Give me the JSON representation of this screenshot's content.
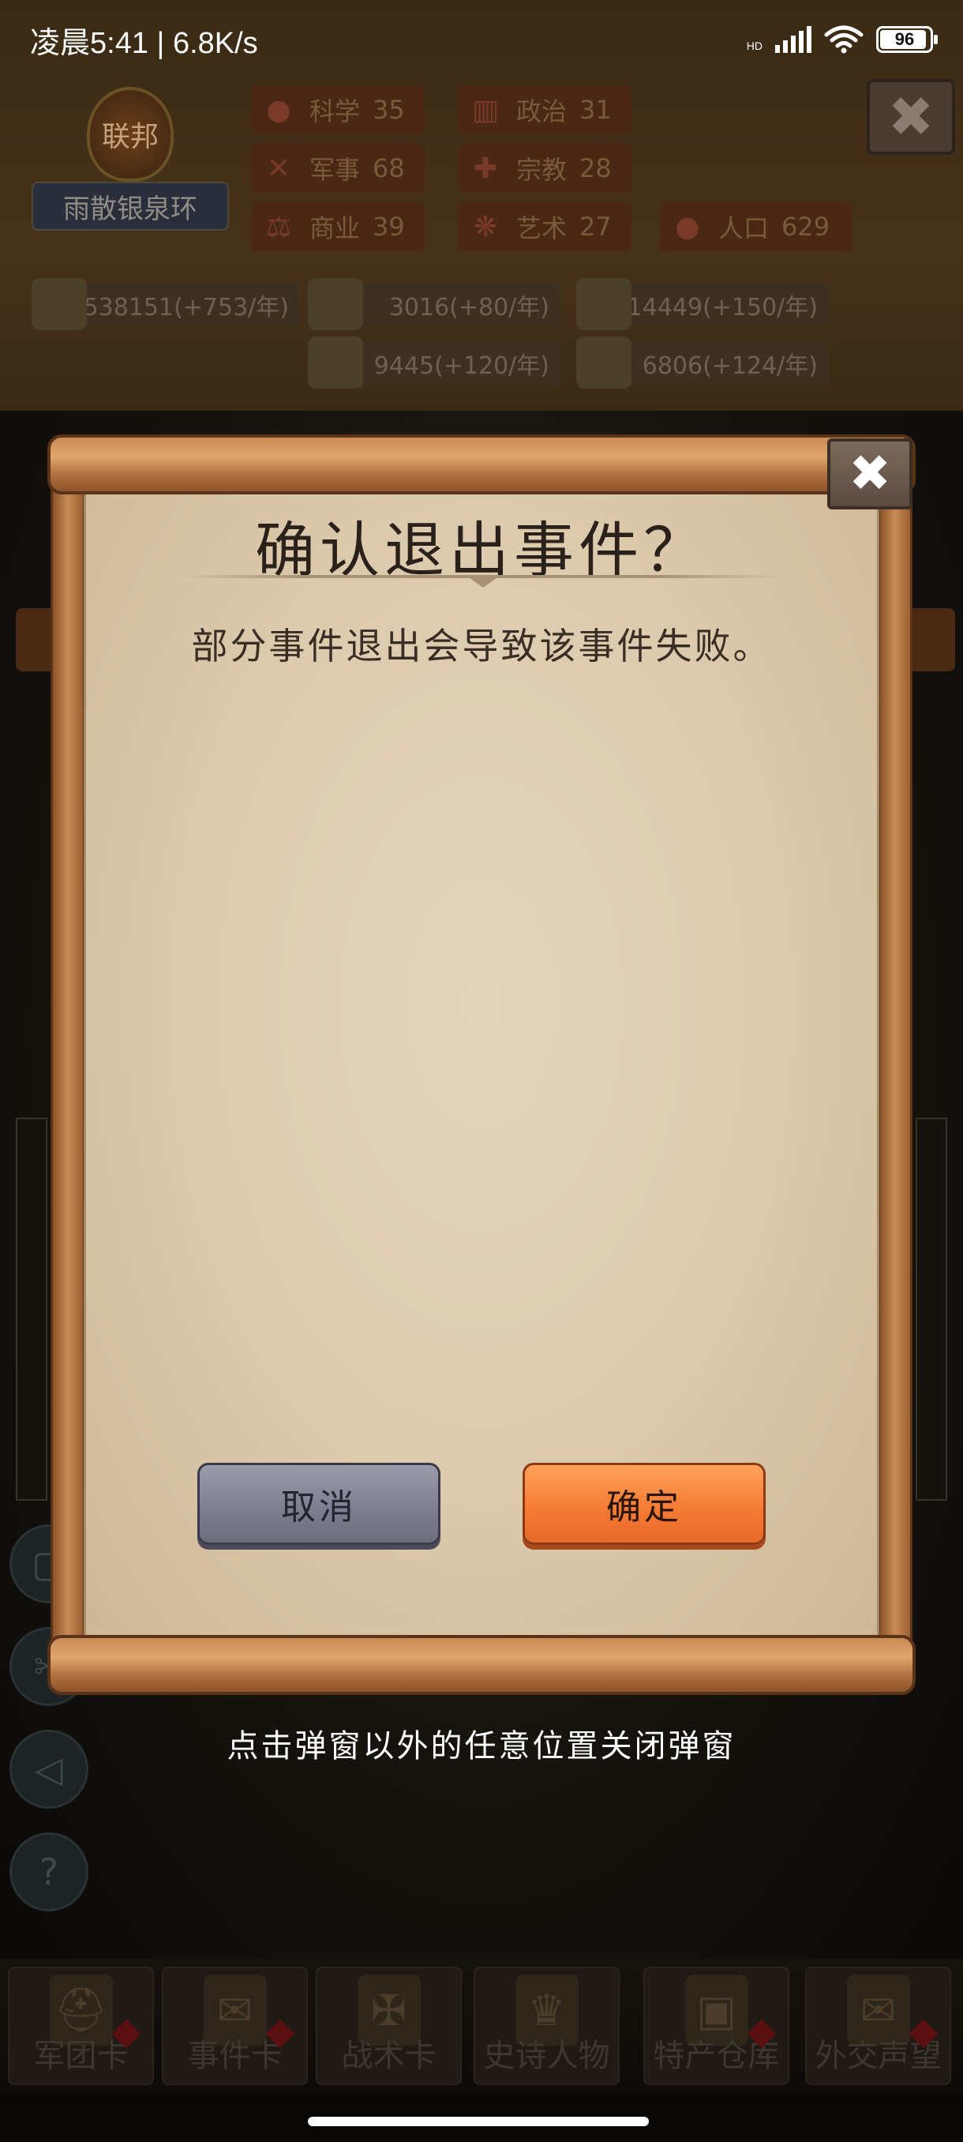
{
  "status_bar": {
    "time_speed": "凌晨5:41 | 6.8K/s",
    "hd_label": "HD",
    "battery": "96"
  },
  "background": {
    "org": {
      "emblem": "联邦",
      "name": "雨散银泉环"
    },
    "stats": [
      {
        "label": "科学",
        "value": "35",
        "icon": "flask-icon"
      },
      {
        "label": "政治",
        "value": "31",
        "icon": "building-icon"
      },
      {
        "label": "军事",
        "value": "68",
        "icon": "swords-icon"
      },
      {
        "label": "宗教",
        "value": "28",
        "icon": "cross-icon"
      },
      {
        "label": "商业",
        "value": "39",
        "icon": "scales-icon"
      },
      {
        "label": "艺术",
        "value": "27",
        "icon": "art-icon"
      },
      {
        "label": "人口",
        "value": "629",
        "icon": "person-icon"
      }
    ],
    "resources": [
      "538151(+753/年)",
      "3016(+80/年)",
      "14449(+150/年)",
      "9445(+120/年)",
      "6806(+124/年)"
    ],
    "tabs": [
      "军团卡",
      "事件卡",
      "战术卡",
      "史诗人物",
      "特产仓库",
      "外交声望"
    ]
  },
  "modal": {
    "title": "确认退出事件？",
    "message": "部分事件退出会导致该事件失败。",
    "cancel_label": "取消",
    "confirm_label": "确定",
    "close_glyph": "✖"
  },
  "hint": "点击弹窗以外的任意位置关闭弹窗"
}
